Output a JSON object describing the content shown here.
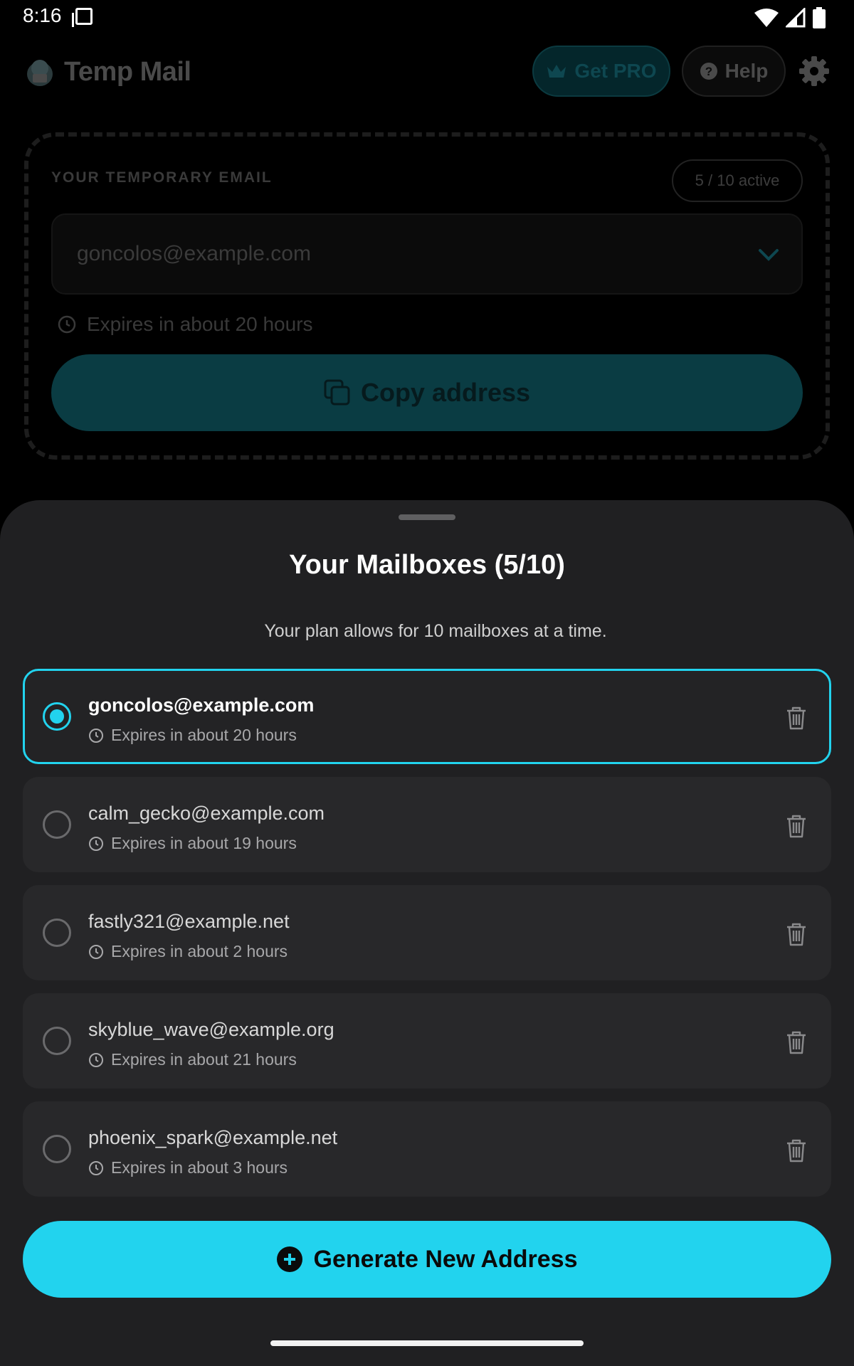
{
  "status_bar": {
    "time": "8:16"
  },
  "header": {
    "app_title": "Temp Mail",
    "get_pro_label": "Get PRO",
    "help_label": "Help"
  },
  "email_card": {
    "label": "YOUR TEMPORARY EMAIL",
    "active_count": "5 / 10 active",
    "current_email": "goncolos@example.com",
    "expiry": "Expires in about 20 hours",
    "copy_label": "Copy address"
  },
  "sheet": {
    "title": "Your Mailboxes (5/10)",
    "subtitle": "Your plan allows for 10 mailboxes at a time.",
    "mailboxes": [
      {
        "address": "goncolos@example.com",
        "expiry": "Expires in about 20 hours",
        "selected": true
      },
      {
        "address": "calm_gecko@example.com",
        "expiry": "Expires in about 19 hours",
        "selected": false
      },
      {
        "address": "fastly321@example.net",
        "expiry": "Expires in about 2 hours",
        "selected": false
      },
      {
        "address": "skyblue_wave@example.org",
        "expiry": "Expires in about 21 hours",
        "selected": false
      },
      {
        "address": "phoenix_spark@example.net",
        "expiry": "Expires in about 3 hours",
        "selected": false
      }
    ],
    "generate_label": "Generate New Address"
  },
  "colors": {
    "accent": "#22d3ee",
    "sheet_bg": "#202022",
    "item_bg": "#28282a"
  },
  "icons": [
    "sim-card-icon",
    "wifi-icon",
    "signal-icon",
    "battery-icon",
    "logo-icon",
    "crown-icon",
    "help-icon",
    "gear-icon",
    "chevron-down-icon",
    "clock-icon",
    "copy-icon",
    "radio-icon",
    "trash-icon",
    "plus-circle-icon"
  ]
}
